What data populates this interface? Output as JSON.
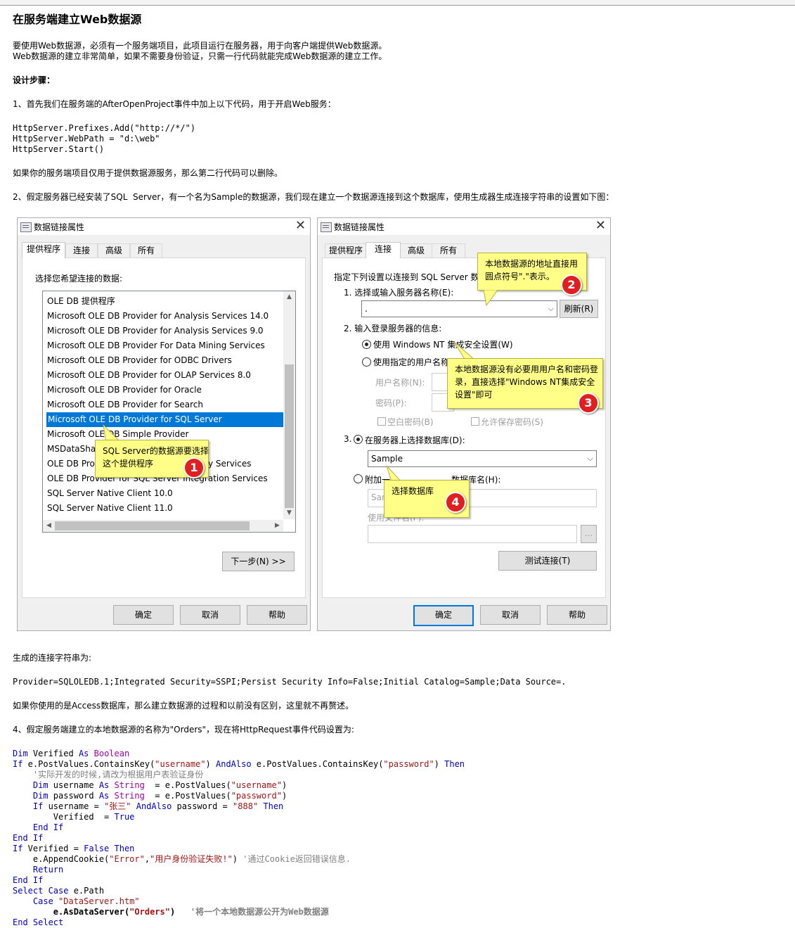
{
  "doc": {
    "title": "在服务端建立Web数据源",
    "intro1": "要使用Web数据源，必须有一个服务端项目，此项目运行在服务器，用于向客户端提供Web数据源。",
    "intro2": "Web数据源的建立非常简单，如果不需要身份验证，只需一行代码就能完成Web数据源的建立工作。",
    "steps_heading": "设计步骤：",
    "step1": "1、首先我们在服务端的AfterOpenProject事件中加上以下代码，用于开启Web服务：",
    "code1": [
      "HttpServer.Prefixes.Add(\"http://*/\")",
      "HttpServer.WebPath = \"d:\\web\"",
      "HttpServer.Start()"
    ],
    "note1": "如果你的服务端项目仅用于提供数据源服务，那么第二行代码可以删除。",
    "step2": "2、假定服务器已经安装了SQL  Server，有一个名为Sample的数据源，我们现在建立一个数据源连接到这个数据库，使用生成器生成连接字符串的设置如下图：",
    "conn_heading": "生成的连接字符串为:",
    "conn_string": "Provider=SQLOLEDB.1;Integrated Security=SSPI;Persist Security Info=False;Initial Catalog=Sample;Data Source=.",
    "access_note": "如果你使用的是Access数据库，那么建立数据源的过程和以前没有区别，这里就不再赘述。",
    "step4": "4、假定服务端建立的本地数据源的名称为\"Orders\"，现在将HttpRequest事件代码设置为:"
  },
  "dialog_left": {
    "title": "数据链接属性",
    "tabs": [
      "提供程序",
      "连接",
      "高级",
      "所有"
    ],
    "prompt": "选择您希望连接的数据:",
    "providers": [
      "OLE DB 提供程序",
      "Microsoft OLE DB Provider for Analysis Services 14.0",
      "Microsoft OLE DB Provider for Analysis Services 9.0",
      "Microsoft OLE DB Provider For Data Mining Services",
      "Microsoft OLE DB Provider for ODBC Drivers",
      "Microsoft OLE DB Provider for OLAP Services 8.0",
      "Microsoft OLE DB Provider for Oracle",
      "Microsoft OLE DB Provider for Search",
      "Microsoft OLE DB Provider for SQL Server",
      "Microsoft OLE DB Simple Provider",
      "MSDataShape",
      "OLE DB Provider for Microsoft Directory Services",
      "OLE DB Provider for SQL Server Integration Services",
      "SQL Server Native Client 10.0",
      "SQL Server Native Client 11.0"
    ],
    "selected_index": 8,
    "next_button": "下一步(N) >>",
    "ok": "确定",
    "cancel": "取消",
    "help": "帮助"
  },
  "dialog_right": {
    "title": "数据链接属性",
    "tabs": [
      "提供程序",
      "连接",
      "高级",
      "所有"
    ],
    "instruction": "指定下列设置以连接到 SQL Server 数",
    "s1_label": "1. 选择或输入服务器名称(E):",
    "server_value": ".",
    "refresh": "刷新(R)",
    "s2_label": "2. 输入登录服务器的信息:",
    "radio_nt": "使用 Windows NT 集成安全设置(W)",
    "radio_user": "使用指定的用户名称",
    "user_label": "用户名称(N):",
    "pwd_label": "密码(P):",
    "blank_pwd": "空白密码(B)",
    "save_pwd": "允许保存密码(S)",
    "s3_label": "3.",
    "radio_db": "在服务器上选择数据库(D):",
    "db_value": "Sample",
    "radio_attach": "附加一",
    "attach_tail": "数据库名(H):",
    "attach_value": "Sam",
    "file_label": "使用文件名(F):",
    "browse": "...",
    "test": "测试连接(T)",
    "ok": "确定",
    "cancel": "取消",
    "help": "帮助"
  },
  "callouts": {
    "c1": [
      "SQL Server的数据源要选择",
      "这个提供程序"
    ],
    "c2": [
      "本地数据源的地址直接用",
      "圆点符号\".\"表示。"
    ],
    "c3": [
      "本地数据源没有必要用用户名和密码登",
      "录，直接选择\"Windows NT集成安全",
      "设置\"即可"
    ],
    "c4": [
      "选择数据库"
    ],
    "b1": "1",
    "b2": "2",
    "b3": "3",
    "b4": "4"
  },
  "code": {
    "l1a": "Dim",
    "l1b": " Verified ",
    "l1c": "As",
    "l1d": " Boolean",
    "l2a": "If",
    "l2b": " e.PostValues.ContainsKey(",
    "l2c": "\"username\"",
    "l2d": ") ",
    "l2e": "AndAlso",
    "l2f": " e.PostValues.ContainsKey(",
    "l2g": "\"password\"",
    "l2h": ") ",
    "l2i": "Then",
    "l3": "    '实际开发的时候,请改为根据用户表验证身份",
    "l4a": "    Dim",
    "l4b": " username ",
    "l4c": "As",
    "l4d": " String",
    "l4e": "  = e.PostValues(",
    "l4f": "\"username\"",
    "l4g": ")",
    "l5a": "    Dim",
    "l5b": " password ",
    "l5c": "As",
    "l5d": " String",
    "l5e": "  = e.PostValues(",
    "l5f": "\"password\"",
    "l5g": ")",
    "l6a": "    If",
    "l6b": " username = ",
    "l6c": "\"张三\"",
    "l6d": " AndAlso",
    "l6e": " password = ",
    "l6f": "\"888\"",
    "l6g": " Then",
    "l7a": "        Verified  = ",
    "l7b": "True",
    "l8": "    End If",
    "l9": "End If",
    "l10a": "If",
    "l10b": " Verified = ",
    "l10c": "False",
    "l10d": " Then",
    "l11a": "    e.AppendCookie(",
    "l11b": "\"Error\"",
    "l11c": ",",
    "l11d": "\"用户身份验证失败!\"",
    "l11e": ") ",
    "l11f": "'通过Cookie返回错误信息.",
    "l12": "    Return",
    "l13": "End If",
    "l14a": "Select Case",
    "l14b": " e.Path",
    "l15a": "    Case",
    "l15b": " \"DataServer.htm\"",
    "l16a": "        e.AsDataServer(",
    "l16b": "\"Orders\"",
    "l16c": ")",
    "l16d": "   '将一个本地数据源公开为Web数据源",
    "l17": "End Select"
  }
}
